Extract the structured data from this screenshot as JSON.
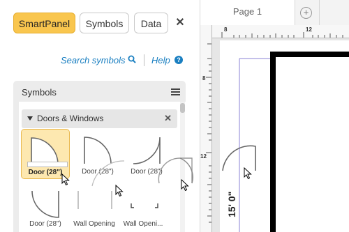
{
  "left_panel": {
    "tabs": [
      {
        "label": "SmartPanel",
        "active": true
      },
      {
        "label": "Symbols",
        "active": false
      },
      {
        "label": "Data",
        "active": false
      }
    ],
    "close_icon": "close-icon",
    "search_link": "Search symbols",
    "help_link": "Help",
    "help_icon_glyph": "?",
    "symbols_panel": {
      "title": "Symbols",
      "library": {
        "title": "Doors & Windows",
        "items": [
          {
            "label": "Door (28\")",
            "selected": true
          },
          {
            "label": "Door (28\")"
          },
          {
            "label": "Door (28\")"
          },
          {
            "label": "Door (28\")"
          },
          {
            "label": "Wall Opening"
          },
          {
            "label": "Wall Openi..."
          }
        ]
      }
    }
  },
  "canvas": {
    "page_tab": "Page 1",
    "add_page_glyph": "+",
    "ruler_h": [
      "8",
      "12"
    ],
    "ruler_v": [
      "8",
      "12"
    ],
    "dimension_label": "15' 0\""
  },
  "colors": {
    "accent": "#f9c64e",
    "link": "#1a7fc1"
  }
}
